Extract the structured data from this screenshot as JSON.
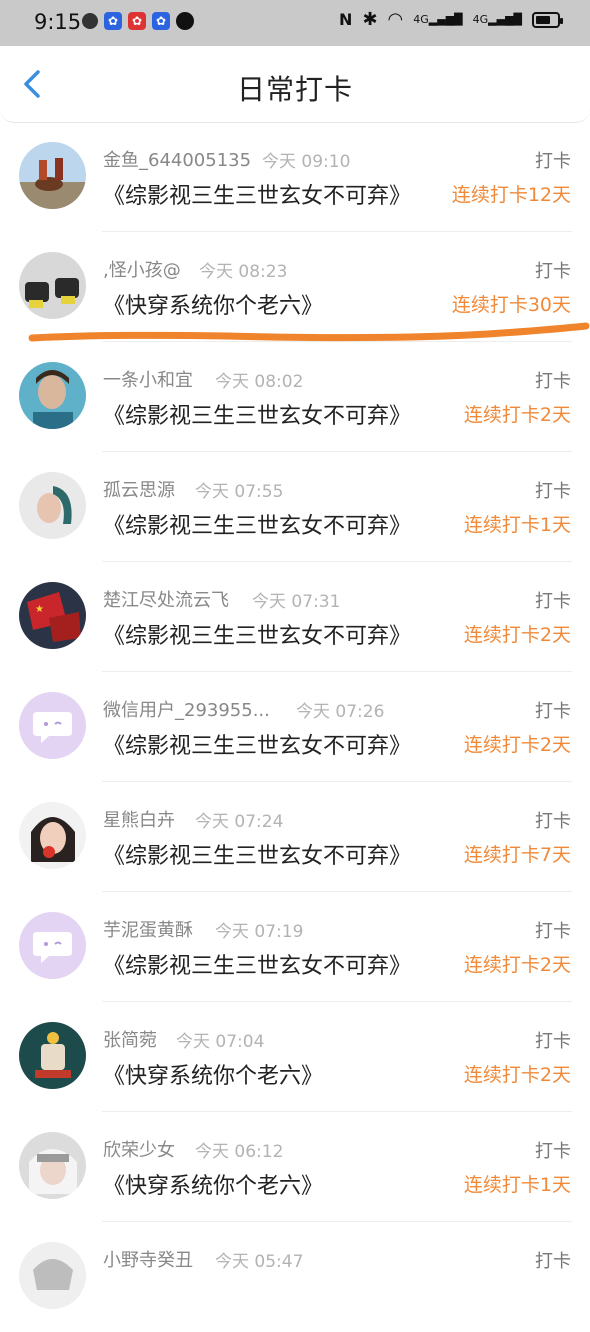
{
  "status_bar": {
    "time": "9:15",
    "network_label": "4G",
    "network_label_2": "4G"
  },
  "header": {
    "title": "日常打卡"
  },
  "colors": {
    "accent_orange": "#f08a3a",
    "back_blue": "#3a8de0",
    "status_gray": "#c9c9c9"
  },
  "entries": [
    {
      "name": "金鱼_644005135",
      "time": "今天 09:10",
      "book": "《综影视三生三世玄女不可弃》",
      "action": "打卡",
      "streak": "连续打卡12天"
    },
    {
      "name": ",怪小孩@",
      "time": "今天 08:23",
      "book": "《快穿系统你个老六》",
      "action": "打卡",
      "streak": "连续打卡30天"
    },
    {
      "name": "一条小和宜",
      "time": "今天 08:02",
      "book": "《综影视三生三世玄女不可弃》",
      "action": "打卡",
      "streak": "连续打卡2天"
    },
    {
      "name": "孤云思源",
      "time": "今天 07:55",
      "book": "《综影视三生三世玄女不可弃》",
      "action": "打卡",
      "streak": "连续打卡1天"
    },
    {
      "name": "楚江尽处流云飞",
      "time": "今天 07:31",
      "book": "《综影视三生三世玄女不可弃》",
      "action": "打卡",
      "streak": "连续打卡2天"
    },
    {
      "name": "微信用户_293955...",
      "time": "今天 07:26",
      "book": "《综影视三生三世玄女不可弃》",
      "action": "打卡",
      "streak": "连续打卡2天"
    },
    {
      "name": "星熊白卉",
      "time": "今天 07:24",
      "book": "《综影视三生三世玄女不可弃》",
      "action": "打卡",
      "streak": "连续打卡7天"
    },
    {
      "name": "芋泥蛋黄酥",
      "time": "今天 07:19",
      "book": "《综影视三生三世玄女不可弃》",
      "action": "打卡",
      "streak": "连续打卡2天"
    },
    {
      "name": "张简菀",
      "time": "今天 07:04",
      "book": "《快穿系统你个老六》",
      "action": "打卡",
      "streak": "连续打卡2天"
    },
    {
      "name": "欣荣少女",
      "time": "今天 06:12",
      "book": "《快穿系统你个老六》",
      "action": "打卡",
      "streak": "连续打卡1天"
    },
    {
      "name": "小野寺癸丑",
      "time": "今天 05:47",
      "book": "",
      "action": "打卡",
      "streak": ""
    }
  ]
}
